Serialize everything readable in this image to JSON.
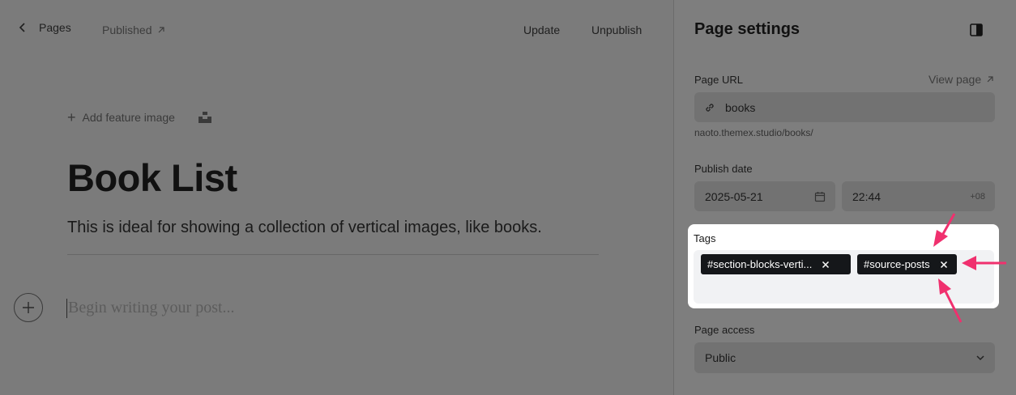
{
  "topbar": {
    "back_label": "Pages",
    "status_label": "Published",
    "update_label": "Update",
    "unpublish_label": "Unpublish"
  },
  "editor": {
    "add_feature_label": "Add feature image",
    "title": "Book List",
    "excerpt": "This is ideal for showing a collection of vertical images, like books.",
    "body_placeholder": "Begin writing your post..."
  },
  "settings": {
    "title": "Page settings",
    "url_label": "Page URL",
    "view_page_label": "View page",
    "url_value": "books",
    "url_hint": "naoto.themex.studio/books/",
    "publish_date_label": "Publish date",
    "date_value": "2025-05-21",
    "time_value": "22:44",
    "timezone": "+08",
    "tags_label": "Tags",
    "tags": [
      {
        "label": "#section-blocks-verti..."
      },
      {
        "label": "#source-posts"
      }
    ],
    "access_label": "Page access",
    "access_value": "Public"
  },
  "colors": {
    "annotation_arrow": "#f0306e",
    "tag_bg": "#15171a"
  }
}
